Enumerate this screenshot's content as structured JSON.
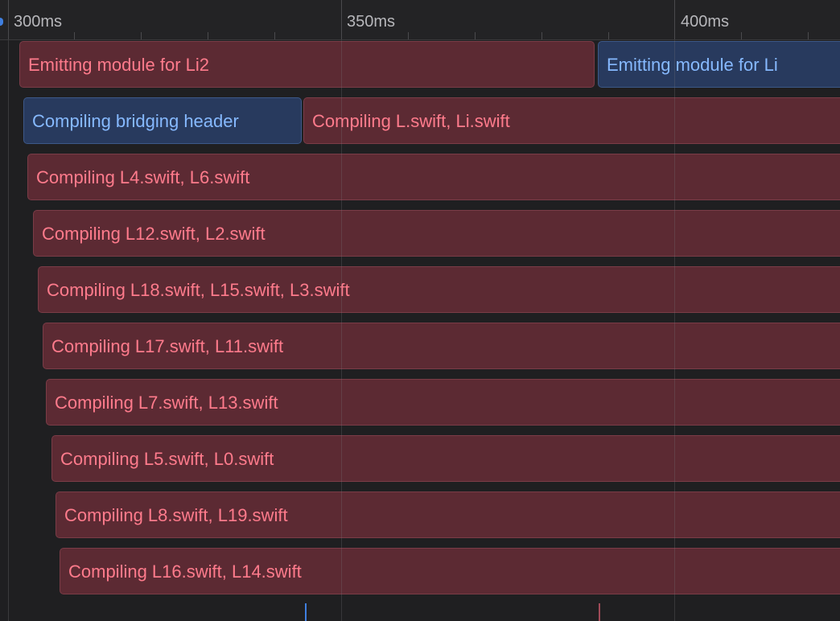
{
  "ruler": {
    "labels": [
      "300ms",
      "350ms",
      "400ms"
    ]
  },
  "tasks": [
    {
      "label": "Emitting module for Li2",
      "kind": "swift-task"
    },
    {
      "label": "Emitting module for Li",
      "kind": "bridging-task"
    },
    {
      "label": "Compiling bridging header",
      "kind": "bridging-task"
    },
    {
      "label": "Compiling L.swift, Li.swift",
      "kind": "swift-task"
    },
    {
      "label": "Compiling L4.swift, L6.swift",
      "kind": "swift-task"
    },
    {
      "label": "Compiling L12.swift, L2.swift",
      "kind": "swift-task"
    },
    {
      "label": "Compiling L18.swift, L15.swift, L3.swift",
      "kind": "swift-task"
    },
    {
      "label": "Compiling L17.swift, L11.swift",
      "kind": "swift-task"
    },
    {
      "label": "Compiling L7.swift, L13.swift",
      "kind": "swift-task"
    },
    {
      "label": "Compiling L5.swift, L0.swift",
      "kind": "swift-task"
    },
    {
      "label": "Compiling L8.swift, L19.swift",
      "kind": "swift-task"
    },
    {
      "label": "Compiling L16.swift, L14.swift",
      "kind": "swift-task"
    }
  ],
  "colors": {
    "swift_task_fill": "#5c2a33",
    "swift_task_text": "#ff7b8c",
    "bridging_task_fill": "#283a5e",
    "bridging_task_text": "#86b9ff",
    "playhead": "#3f7fe0"
  }
}
